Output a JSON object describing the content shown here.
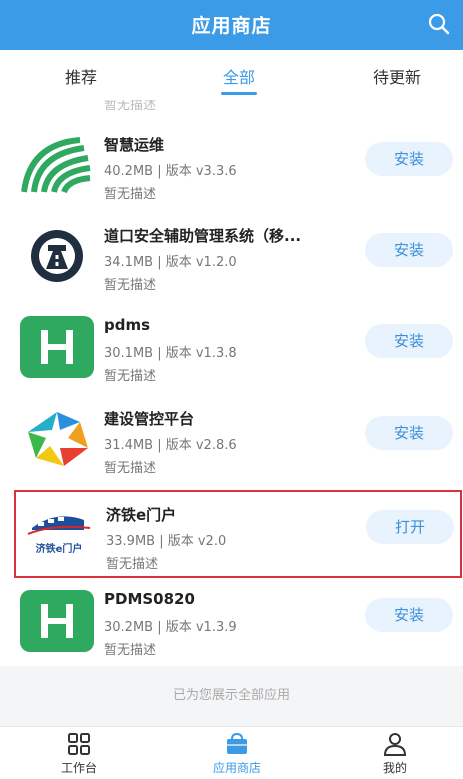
{
  "header": {
    "title": "应用商店"
  },
  "tabs": [
    {
      "label": "推荐",
      "active": false
    },
    {
      "label": "全部",
      "active": true
    },
    {
      "label": "待更新",
      "active": false
    }
  ],
  "ghost_item": {
    "desc": "暂无描述"
  },
  "apps": [
    {
      "name": "智慧运维",
      "meta": "40.2MB | 版本 v3.3.6",
      "desc": "暂无描述",
      "button": "安装",
      "icon": "green-swoosh-icon"
    },
    {
      "name": "道口安全辅助管理系统（移...",
      "meta": "34.1MB | 版本 v1.2.0",
      "desc": "暂无描述",
      "button": "安装",
      "icon": "road-sign-icon"
    },
    {
      "name": "pdms",
      "meta": "30.1MB | 版本 v1.3.8",
      "desc": "暂无描述",
      "button": "安装",
      "icon": "green-h-icon"
    },
    {
      "name": "建设管控平台",
      "meta": "31.4MB | 版本 v2.8.6",
      "desc": "暂无描述",
      "button": "安装",
      "icon": "colorful-hexagon-icon"
    },
    {
      "name": "济铁e门户",
      "meta": "33.9MB | 版本 v2.0",
      "desc": "暂无描述",
      "button": "打开",
      "icon": "train-logo-icon",
      "icon_text": "济铁e门户"
    },
    {
      "name": "PDMS0820",
      "meta": "30.2MB | 版本 v1.3.9",
      "desc": "暂无描述",
      "button": "安装",
      "icon": "green-h-icon"
    }
  ],
  "footer_note": "已为您展示全部应用",
  "nav": [
    {
      "label": "工作台",
      "icon": "grid-icon",
      "active": false
    },
    {
      "label": "应用商店",
      "icon": "bag-icon",
      "active": true
    },
    {
      "label": "我的",
      "icon": "person-icon",
      "active": false
    }
  ],
  "colors": {
    "primary": "#3c9be6",
    "highlight_border": "#d9323c",
    "button_bg": "#e9f3fd",
    "icon_green": "#2fa860"
  }
}
